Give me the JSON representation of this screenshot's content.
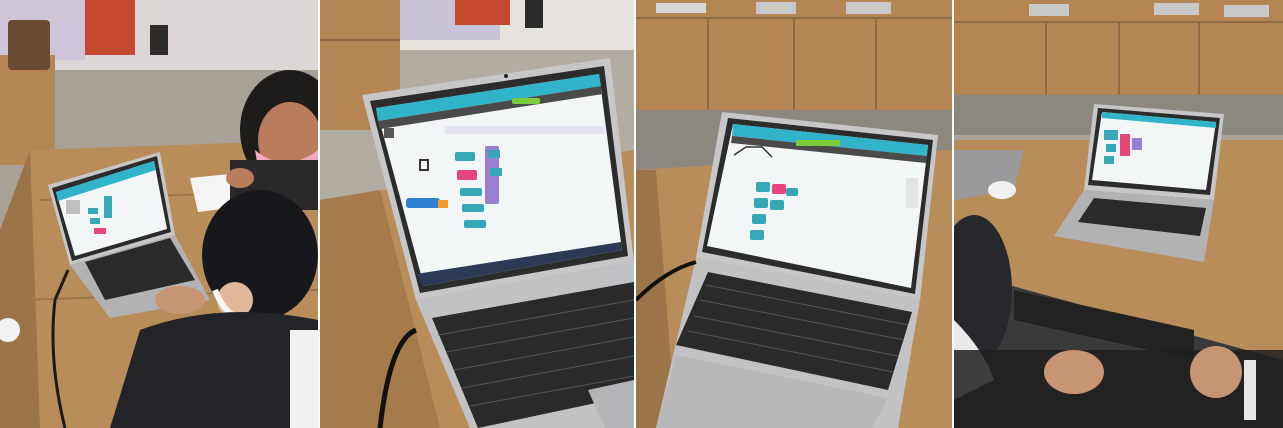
{
  "collage": {
    "panels": [
      {
        "id": "photo-1",
        "scene": "child-girl-at-laptop"
      },
      {
        "id": "photo-2",
        "scene": "laptop-closeup-block-coding"
      },
      {
        "id": "photo-3",
        "scene": "laptop-on-desk-block-coding"
      },
      {
        "id": "photo-4",
        "scene": "child-at-desk-laptop"
      }
    ]
  },
  "colors": {
    "wood": "#b98d5a",
    "wood_dark": "#8d6a44",
    "wall": "#e9e6e2",
    "floor": "#a9a39a",
    "laptop_silver": "#c7c7c9",
    "screen_frame": "#2c2c2c",
    "app_header": "#31b3c9",
    "block_teal": "#37a8b8",
    "block_pink": "#e6457d",
    "block_orange": "#f29a2e",
    "block_purple": "#9a7fd0",
    "block_green": "#7ccb3a",
    "mask_pink": "#f1a8c0",
    "hair": "#1e1b1b",
    "clothing": "#222428"
  }
}
